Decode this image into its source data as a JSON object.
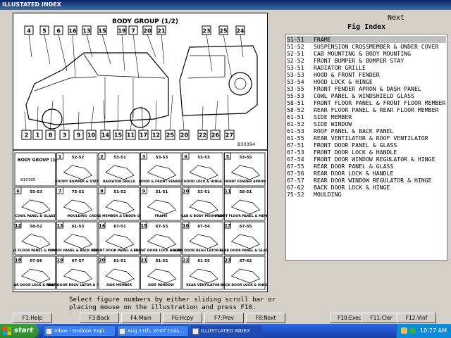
{
  "window": {
    "title": "ILLUSTATED INDEX"
  },
  "illustration": {
    "title": "BODY GROUP (1/2)",
    "code": "B30394",
    "top_callouts": [
      "4",
      "5",
      "6",
      "16",
      "13",
      "15",
      "19",
      "7",
      "20",
      "21",
      "23",
      "25",
      "24"
    ],
    "bottom_callouts": [
      "2",
      "1",
      "8",
      "3",
      "9",
      "10",
      "14",
      "15",
      "11",
      "17",
      "12",
      "25",
      "20",
      "22",
      "26",
      "27"
    ],
    "grid_header": {
      "title": "BODY GROUP (1/2)",
      "code": "B10395"
    },
    "cells": [
      {
        "num": "1",
        "code": "52-52",
        "label": "FRONT BUMPER & STAY"
      },
      {
        "num": "2",
        "code": "53-51",
        "label": "RADIATOR GRILLE"
      },
      {
        "num": "3",
        "code": "53-53",
        "label": "HOOD & FRONT FENDER"
      },
      {
        "num": "4",
        "code": "53-53",
        "label": "HOOD LOCK & HINGE"
      },
      {
        "num": "5",
        "code": "53-55",
        "label": "FRONT FENDER APRON"
      },
      {
        "num": "6",
        "code": "55-53",
        "label": "COWL PANEL & GLASS"
      },
      {
        "num": "7",
        "code": "75-52",
        "label": "MOULDING"
      },
      {
        "num": "8",
        "code": "51-52",
        "label": "CROSS MEMBER & UNDER COVER"
      },
      {
        "num": "9",
        "code": "51-51",
        "label": "FRAME"
      },
      {
        "num": "10",
        "code": "52-51",
        "label": "CAB & BODY MOUNTING"
      },
      {
        "num": "11",
        "code": "58-51",
        "label": "FRONT FLOOR PANEL & MEMBER"
      },
      {
        "num": "12",
        "code": "58-52",
        "label": "REAR FLOOR PANEL & MEMBER"
      },
      {
        "num": "13",
        "code": "61-53",
        "label": "ROOF PANEL & BACK PANEL"
      },
      {
        "num": "14",
        "code": "67-51",
        "label": "FRONT DOOR PANEL & GLASS"
      },
      {
        "num": "15",
        "code": "67-53",
        "label": "FRONT DOOR LOCK & HANDLE"
      },
      {
        "num": "16",
        "code": "67-54",
        "label": "FRONT DOOR REGU LATOR & HINGE"
      },
      {
        "num": "17",
        "code": "67-55",
        "label": "REAR DOOR PANEL & GLASS"
      },
      {
        "num": "18",
        "code": "67-56",
        "label": "REAR DOOR LOCK & HANDLE"
      },
      {
        "num": "19",
        "code": "67-57",
        "label": "REAR DOOR REGU LATOR & HINGE"
      },
      {
        "num": "20",
        "code": "61-51",
        "label": "SIDE MEMBER"
      },
      {
        "num": "21",
        "code": "61-52",
        "label": "SIDE WINDOW"
      },
      {
        "num": "22",
        "code": "61-55",
        "label": "REAR VENTILATOR"
      },
      {
        "num": "23",
        "code": "67-62",
        "label": "BACK DOOR LOCK & HINGE"
      }
    ]
  },
  "right_panel": {
    "next_label": "Next",
    "fig_index_title": "Fig Index",
    "items": [
      {
        "code": "51-51",
        "name": "FRAME"
      },
      {
        "code": "51-52",
        "name": "SUSPENSION CROSSMEMBER & UNDER COVER"
      },
      {
        "code": "52-51",
        "name": "CAB MOUNTING & BODY MOUNTING"
      },
      {
        "code": "52-52",
        "name": "FRONT BUMPER & BUMPER STAY"
      },
      {
        "code": "53-51",
        "name": "RADIATOR GRILLE"
      },
      {
        "code": "53-53",
        "name": "HOOD & FRONT FENDER"
      },
      {
        "code": "53-54",
        "name": "HOOD LOCK & HINGE"
      },
      {
        "code": "53-55",
        "name": "FRONT FENDER APRON & DASH PANEL"
      },
      {
        "code": "55-53",
        "name": "COWL PANEL & WINDSHIELD GLASS"
      },
      {
        "code": "58-51",
        "name": "FRONT FLOOR PANEL & FRONT FLOOR MEMBER"
      },
      {
        "code": "58-52",
        "name": "REAR FLOOR PANEL & REAR FLOOR MEMBER"
      },
      {
        "code": "61-51",
        "name": "SIDE MEMBER"
      },
      {
        "code": "61-52",
        "name": "SIDE WINDOW"
      },
      {
        "code": "61-53",
        "name": "ROOF PANEL & BACK PANEL"
      },
      {
        "code": "61-55",
        "name": "REAR VENTILATOR & ROOF VENTILATOR"
      },
      {
        "code": "67-51",
        "name": "FRONT DOOR PANEL & GLASS"
      },
      {
        "code": "67-53",
        "name": "FRONT DOOR LOCK & HANDLE"
      },
      {
        "code": "67-54",
        "name": "FRONT DOOR WINDOW REGULATOR & HINGE"
      },
      {
        "code": "67-55",
        "name": "REAR DOOR PANEL & GLASS"
      },
      {
        "code": "67-56",
        "name": "REAR DOOR LOCK & HANDLE"
      },
      {
        "code": "67-57",
        "name": "REAR DOOR WINDOW REGULATOR & HINGE"
      },
      {
        "code": "67-62",
        "name": "BACK DOOR LOCK & HINGE"
      },
      {
        "code": "75-52",
        "name": "MOULDING"
      }
    ]
  },
  "instruction": {
    "line1": "Select figure numbers by either sliding scroll bar or",
    "line2": "placing mouse on the illustration and press F10."
  },
  "function_keys": [
    {
      "label": "F1:Help"
    },
    {
      "label": "F3:Back"
    },
    {
      "label": "F4:Main"
    },
    {
      "label": "F6:Hcpy"
    },
    {
      "label": "F7:Prev"
    },
    {
      "label": "F8:Next"
    },
    {
      "label": "F10:Exec"
    },
    {
      "label": "F11:Cler"
    },
    {
      "label": "F12:Vinf"
    }
  ],
  "taskbar": {
    "start_label": "start",
    "tasks": [
      {
        "label": "Inbox - Outlook Expr..."
      },
      {
        "label": "Aug 11th, 2007 Coas..."
      },
      {
        "label": "ILLUSTLATED INDEX"
      }
    ],
    "clock": "10:27 AM"
  }
}
